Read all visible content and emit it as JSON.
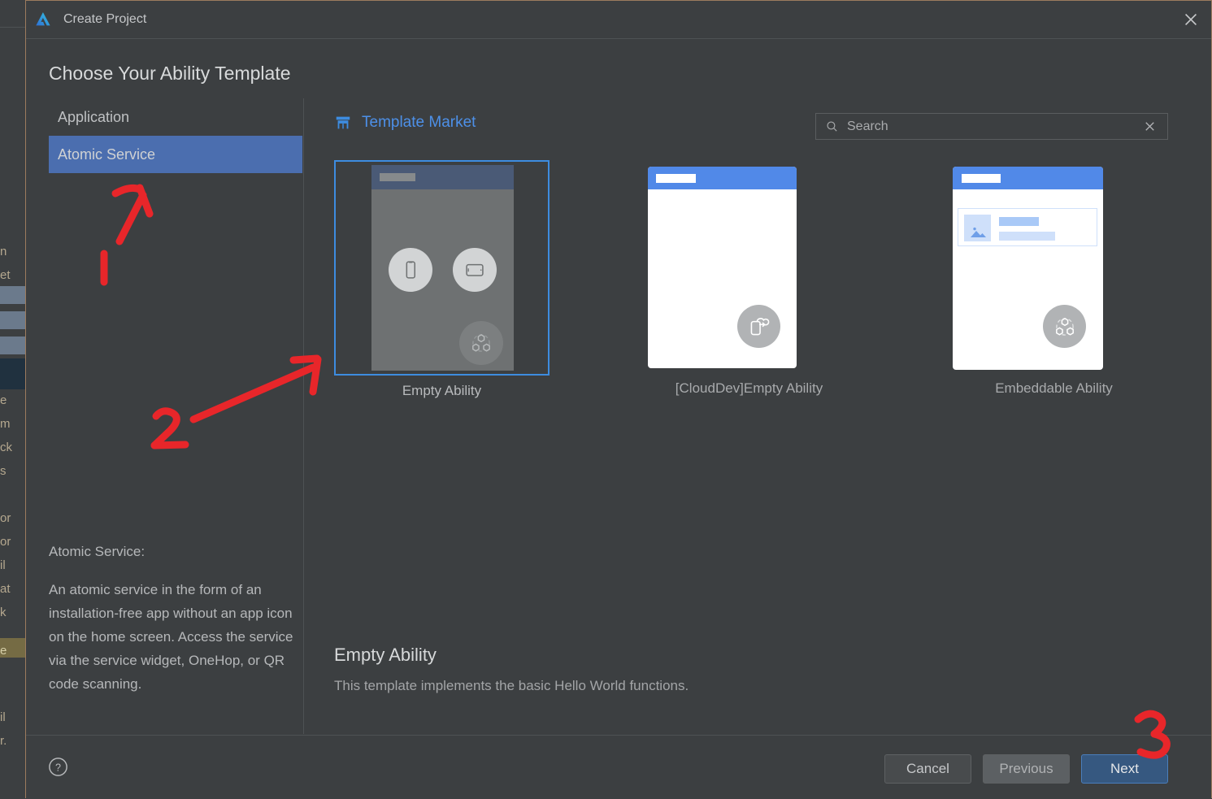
{
  "window": {
    "title": "Create Project",
    "logo_icon": "deveco-logo-icon",
    "close_icon": "close-icon"
  },
  "heading": "Choose Your Ability Template",
  "sidebar": {
    "items": [
      {
        "label": "Application",
        "selected": false
      },
      {
        "label": "Atomic Service",
        "selected": true
      }
    ],
    "description": {
      "title": "Atomic Service:",
      "body": "An atomic service in the form of an installation-free app without an app icon on the home screen. Access the service via the service widget, OneHop, or QR code scanning."
    }
  },
  "market": {
    "icon": "storefront-icon",
    "label": "Template Market"
  },
  "search": {
    "icon": "search-icon",
    "placeholder": "Search",
    "value": "",
    "clear_icon": "close-icon"
  },
  "templates": [
    {
      "caption": "Empty Ability",
      "selected": true,
      "badge_icon": "share-ability-icon"
    },
    {
      "caption": "[CloudDev]Empty Ability",
      "selected": false,
      "badge_icon": "cloud-phone-icon"
    },
    {
      "caption": "Embeddable Ability",
      "selected": false,
      "badge_icon": "share-ability-icon"
    }
  ],
  "selected_template": {
    "name": "Empty Ability",
    "description": "This template implements the basic Hello World functions."
  },
  "footer": {
    "help_icon": "help-circle-icon",
    "cancel_label": "Cancel",
    "previous_label": "Previous",
    "next_label": "Next"
  },
  "annotations": [
    {
      "label": "1",
      "kind": "arrow-to-atomic-service"
    },
    {
      "label": "2",
      "kind": "arrow-to-empty-ability-card"
    },
    {
      "label": "3",
      "kind": "marker-above-next-button"
    }
  ],
  "colors": {
    "accent_blue": "#4b6eaf",
    "link_blue": "#4d90e8",
    "card_blue": "#5189e8",
    "selection_border": "#3d8ce0",
    "next_button": "#365880",
    "annotation_red": "#e8262a",
    "window_bg": "#3c3f41"
  }
}
